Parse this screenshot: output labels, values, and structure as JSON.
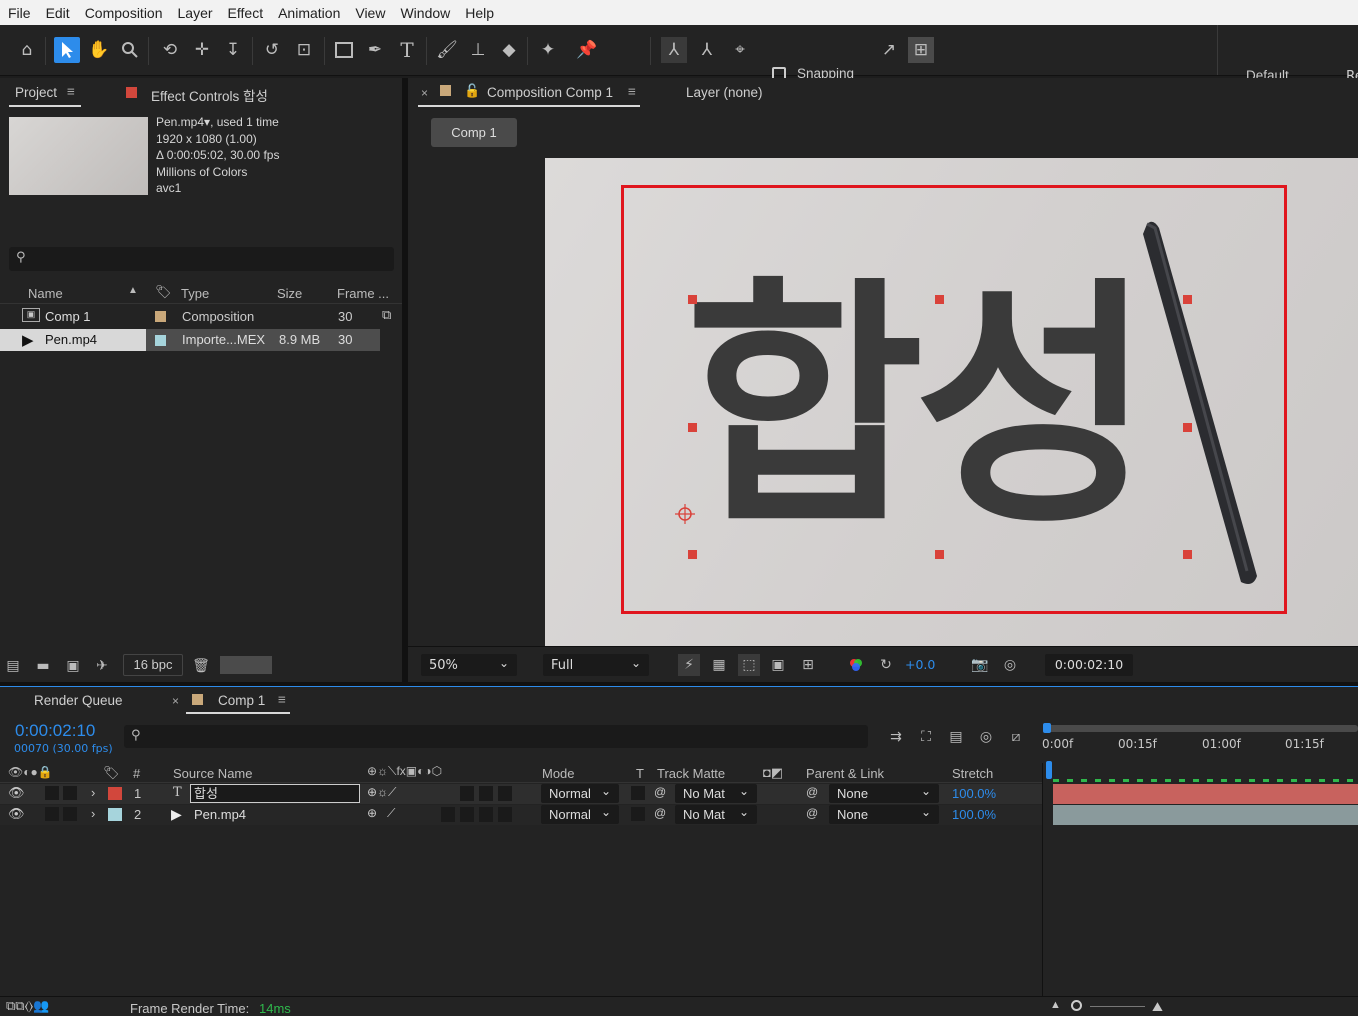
{
  "menu": [
    "File",
    "Edit",
    "Composition",
    "Layer",
    "Effect",
    "Animation",
    "View",
    "Window",
    "Help"
  ],
  "toolbar": {
    "snapping_label": "Snapping",
    "workspace_default": "Default",
    "workspace_cut": "Re"
  },
  "project_panel": {
    "tab_project": "Project",
    "tab_effect_controls": "Effect Controls 합성",
    "footage": {
      "name": "Pen.mp4",
      "used": ", used 1 time",
      "dims": "1920 x 1080 (1.00)",
      "duration": "Δ 0:00:05:02, 30.00 fps",
      "colors": "Millions of Colors",
      "codec": "avc1"
    },
    "search_placeholder": "",
    "columns": [
      "Name",
      "Type",
      "Size",
      "Frame ..."
    ],
    "items": [
      {
        "name": "Comp 1",
        "type": "Composition",
        "size": "",
        "frame": "30",
        "color": "#c9a87a"
      },
      {
        "name": "Pen.mp4",
        "type": "Importe...MEX",
        "size": "8.9 MB",
        "frame": "30",
        "color": "#a6d4dc"
      }
    ],
    "bpc": "16 bpc"
  },
  "comp_panel": {
    "tab_label": "Composition Comp 1",
    "layer_tab": "Layer (none)",
    "breadcrumb": "Comp 1",
    "text_glyphs": "합성",
    "zoom": "50%",
    "resolution": "Full",
    "exposure": "+0.0",
    "timecode": "0:00:02:10"
  },
  "timeline": {
    "tab_render_queue": "Render Queue",
    "tab_comp": "Comp 1",
    "timecode": "0:00:02:10",
    "frame_fps": "00070 (30.00 fps)",
    "columns": {
      "num": "#",
      "source": "Source Name",
      "mode": "Mode",
      "t": "T",
      "track_matte": "Track Matte",
      "parent": "Parent & Link",
      "stretch": "Stretch"
    },
    "ruler": [
      "0:00f",
      "00:15f",
      "01:00f",
      "01:15f"
    ],
    "layers": [
      {
        "num": "1",
        "name": "합성",
        "mode": "Normal",
        "matte": "No Mat",
        "parent": "None",
        "stretch": "100.0%",
        "label": "#d2473c"
      },
      {
        "num": "2",
        "name": "Pen.mp4",
        "mode": "Normal",
        "matte": "No Mat",
        "parent": "None",
        "stretch": "100.0%",
        "label": "#a6d4dc"
      }
    ],
    "render_time_label": "Frame Render Time:",
    "render_time_value": "14ms"
  },
  "colors": {
    "accent": "#2d8ceb",
    "red_box": "#e0161e",
    "layer1_bar": "#c8625e",
    "layer2_bar": "#8a9a9c"
  }
}
